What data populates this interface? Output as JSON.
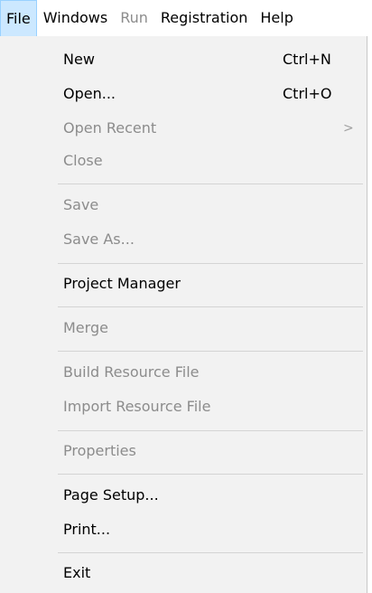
{
  "menubar": {
    "items": [
      {
        "label": "File",
        "state": "active"
      },
      {
        "label": "Windows",
        "state": "enabled"
      },
      {
        "label": "Run",
        "state": "disabled"
      },
      {
        "label": "Registration",
        "state": "enabled"
      },
      {
        "label": "Help",
        "state": "enabled"
      }
    ]
  },
  "file_menu": {
    "items": [
      {
        "label": "New",
        "shortcut": "Ctrl+N",
        "enabled": true
      },
      {
        "label": "Open...",
        "shortcut": "Ctrl+O",
        "enabled": true
      },
      {
        "label": "Open Recent",
        "enabled": false,
        "submenu": true,
        "submenu_glyph": ">"
      },
      {
        "label": "Close",
        "enabled": false
      },
      {
        "label": "Save",
        "enabled": false
      },
      {
        "label": "Save As...",
        "enabled": false
      },
      {
        "label": "Project Manager",
        "enabled": true
      },
      {
        "label": "Merge",
        "enabled": false
      },
      {
        "label": "Build Resource File",
        "enabled": false
      },
      {
        "label": "Import Resource File",
        "enabled": false
      },
      {
        "label": "Properties",
        "enabled": false
      },
      {
        "label": "Page Setup...",
        "enabled": true
      },
      {
        "label": "Print...",
        "enabled": true
      },
      {
        "label": "Exit",
        "enabled": true
      }
    ]
  },
  "colors": {
    "menubar_active_bg": "#cce8ff",
    "menubar_active_border": "#99d1ff",
    "menu_bg": "#f2f2f2",
    "disabled_text": "#8c8c8c",
    "separator": "#d4d4d4"
  }
}
